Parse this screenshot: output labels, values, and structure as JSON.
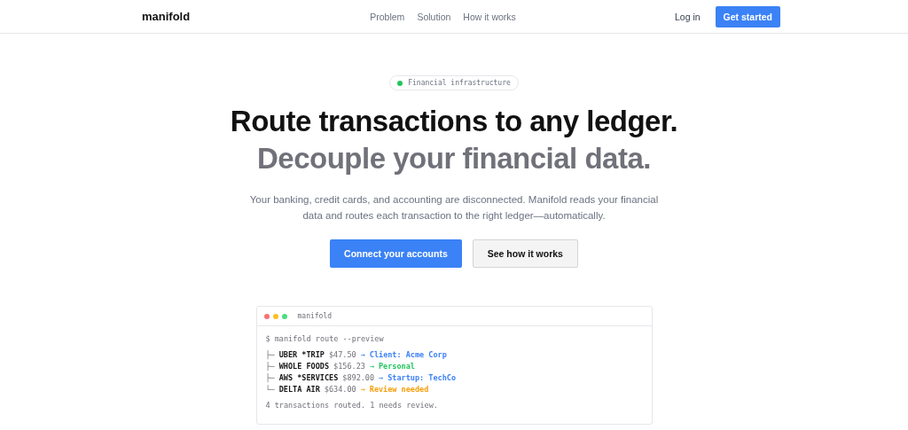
{
  "nav": {
    "logo": "manifold",
    "links": [
      "Problem",
      "Solution",
      "How it works"
    ],
    "login": "Log in",
    "cta": "Get started"
  },
  "badge": {
    "label": "Financial infrastructure",
    "color": "#22c55e"
  },
  "headline": [
    "Route transactions to any ledger.",
    "Decouple your financial data."
  ],
  "subtitle": "Your banking, credit cards, and accounting are disconnected. Manifold reads your financial data and routes each transaction to the right ledger—automatically.",
  "buttons": [
    {
      "label": "Connect your accounts",
      "kind": "primary"
    },
    {
      "label": "See how it works",
      "kind": "secondary"
    }
  ],
  "terminal": {
    "title": "manifold",
    "command": "$ manifold route --preview",
    "rows": [
      {
        "branch": "├─",
        "merchant": "UBER *TRIP",
        "amount": "$47.50",
        "arrow": "→",
        "target": "Client: Acme Corp",
        "color": "#3b82f6"
      },
      {
        "branch": "├─",
        "merchant": "WHOLE FOODS",
        "amount": "$156.23",
        "arrow": "→",
        "target": "Personal",
        "color": "#22c55e"
      },
      {
        "branch": "├─",
        "merchant": "AWS *SERVICES",
        "amount": "$892.00",
        "arrow": "→",
        "target": "Startup: TechCo",
        "color": "#3b82f6"
      },
      {
        "branch": "└─",
        "merchant": "DELTA AIR",
        "amount": "$634.00",
        "arrow": "→",
        "target": "Review needed",
        "color": "#f59e0b"
      }
    ],
    "summary": "4 transactions routed. 1 needs review."
  }
}
